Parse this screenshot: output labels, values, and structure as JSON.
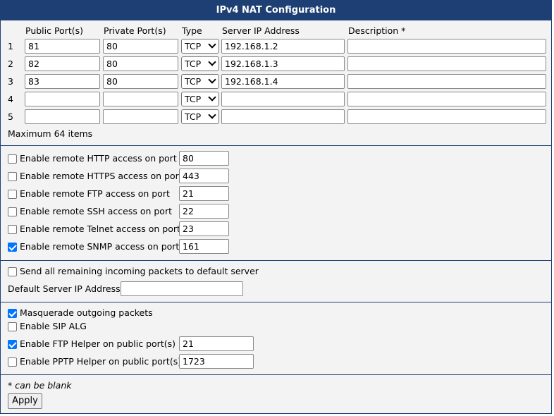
{
  "title": "IPv4 NAT Configuration",
  "table": {
    "headers": {
      "public_ports": "Public Port(s)",
      "private_ports": "Private Port(s)",
      "type": "Type",
      "server_ip": "Server IP Address",
      "description": "Description *"
    },
    "rows": [
      {
        "num": "1",
        "public": "81",
        "private": "80",
        "type": "TCP",
        "ip": "192.168.1.2",
        "description": ""
      },
      {
        "num": "2",
        "public": "82",
        "private": "80",
        "type": "TCP",
        "ip": "192.168.1.3",
        "description": ""
      },
      {
        "num": "3",
        "public": "83",
        "private": "80",
        "type": "TCP",
        "ip": "192.168.1.4",
        "description": ""
      },
      {
        "num": "4",
        "public": "",
        "private": "",
        "type": "TCP",
        "ip": "",
        "description": ""
      },
      {
        "num": "5",
        "public": "",
        "private": "",
        "type": "TCP",
        "ip": "",
        "description": ""
      }
    ],
    "max_items": "Maximum 64 items"
  },
  "remote_access": [
    {
      "label": "Enable remote HTTP access on port",
      "port": "80",
      "checked": false
    },
    {
      "label": "Enable remote HTTPS access on port",
      "port": "443",
      "checked": false
    },
    {
      "label": "Enable remote FTP access on port",
      "port": "21",
      "checked": false
    },
    {
      "label": "Enable remote SSH access on port",
      "port": "22",
      "checked": false
    },
    {
      "label": "Enable remote Telnet access on port",
      "port": "23",
      "checked": false
    },
    {
      "label": "Enable remote SNMP access on port",
      "port": "161",
      "checked": true
    }
  ],
  "default_server": {
    "send_label": "Send all remaining incoming packets to default server",
    "send_checked": false,
    "ip_label": "Default Server IP Address",
    "ip_value": ""
  },
  "options": {
    "masquerade": {
      "label": "Masquerade outgoing packets",
      "checked": true
    },
    "sip_alg": {
      "label": "Enable SIP ALG",
      "checked": false
    },
    "ftp_helper": {
      "label": "Enable FTP Helper on public port(s)",
      "value": "21",
      "checked": true
    },
    "pptp_helper": {
      "label": "Enable PPTP Helper on public port(s)",
      "value": "1723",
      "checked": false
    }
  },
  "footer": {
    "note": "* can be blank",
    "apply_label": "Apply"
  }
}
